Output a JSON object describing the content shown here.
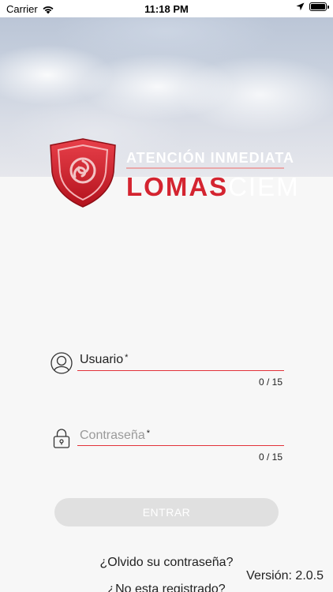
{
  "status_bar": {
    "carrier": "Carrier",
    "time": "11:18 PM"
  },
  "logo": {
    "tagline": "ATENCIÓN INMEDIATA",
    "brand_primary": "LOMAS",
    "brand_secondary": "CIEM",
    "brand_color": "#d42430"
  },
  "form": {
    "username": {
      "label": "Usuario",
      "required_mark": "*",
      "counter": "0 / 15",
      "icon": "user-icon"
    },
    "password": {
      "label": "Contraseña",
      "required_mark": "*",
      "counter": "0 / 15",
      "icon": "lock-icon"
    },
    "submit_label": "ENTRAR",
    "underline_color": "#e3333a"
  },
  "links": {
    "forgot_password": "¿Olvido su contraseña?",
    "register": "¿No esta registrado?"
  },
  "version": "Versión: 2.0.5"
}
